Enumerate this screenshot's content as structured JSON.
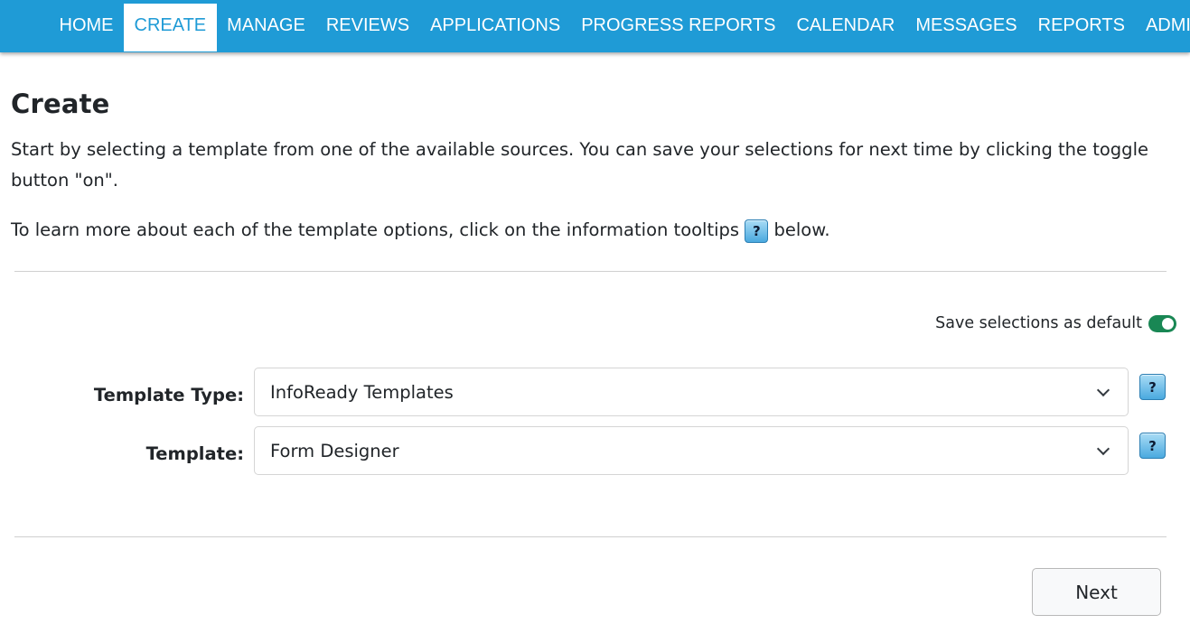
{
  "nav": {
    "items": [
      {
        "label": "HOME"
      },
      {
        "label": "CREATE"
      },
      {
        "label": "MANAGE"
      },
      {
        "label": "REVIEWS"
      },
      {
        "label": "APPLICATIONS"
      },
      {
        "label": "PROGRESS REPORTS"
      },
      {
        "label": "CALENDAR"
      },
      {
        "label": "MESSAGES"
      },
      {
        "label": "REPORTS"
      },
      {
        "label": "ADMI"
      }
    ],
    "active": "CREATE",
    "background_color": "#1f9bd6"
  },
  "page": {
    "title": "Create",
    "intro": "Start by selecting a template from one of the available sources. You can save your selections for next time by clicking the toggle button \"on\".",
    "learn_prefix": "To learn more about each of the template options, click on the information tooltips",
    "learn_suffix": "below.",
    "help_glyph": "?"
  },
  "toggle": {
    "label": "Save selections as default",
    "state": "on",
    "color": "#198754"
  },
  "form": {
    "template_type": {
      "label": "Template Type:",
      "value": "InfoReady Templates"
    },
    "template": {
      "label": "Template:",
      "value": "Form Designer"
    }
  },
  "actions": {
    "next_label": "Next"
  }
}
